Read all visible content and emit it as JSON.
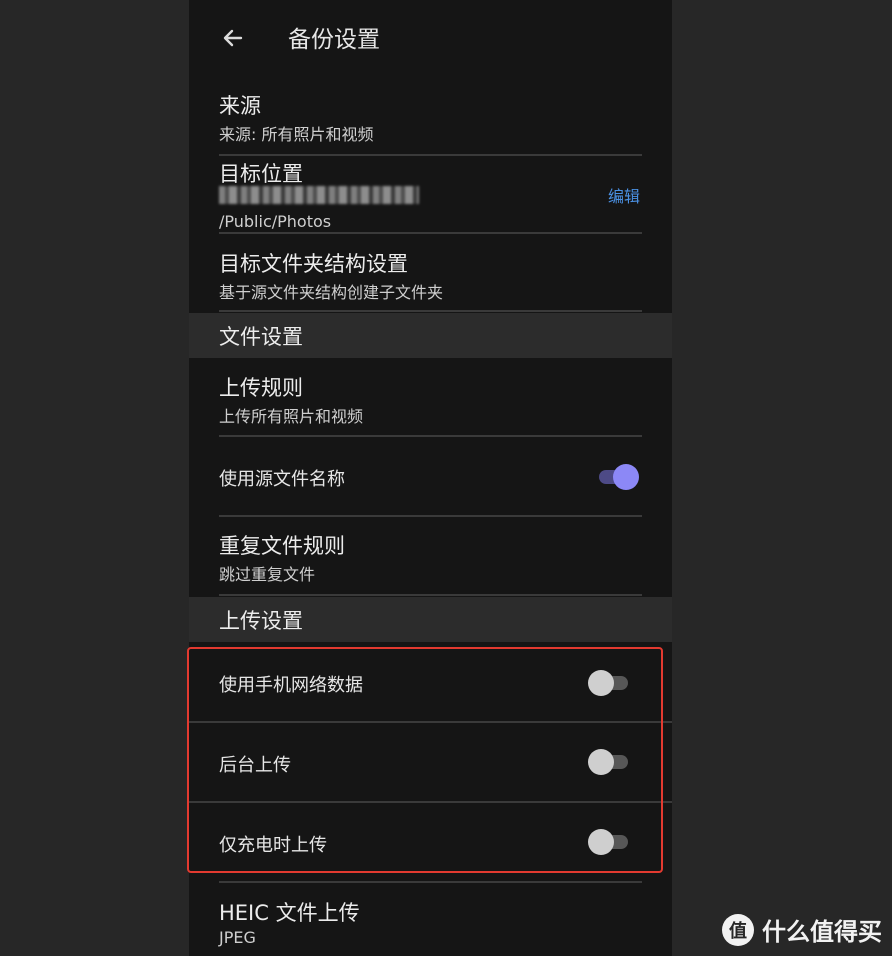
{
  "header": {
    "title": "备份设置"
  },
  "source": {
    "title": "来源",
    "subtitle": "来源: 所有照片和视频"
  },
  "target": {
    "title": "目标位置",
    "path": "/Public/Photos",
    "edit_label": "编辑"
  },
  "folder_structure": {
    "title": "目标文件夹结构设置",
    "subtitle": "基于源文件夹结构创建子文件夹"
  },
  "file_settings": {
    "section_title": "文件设置"
  },
  "upload_rule": {
    "title": "上传规则",
    "subtitle": "上传所有照片和视频"
  },
  "use_source_name": {
    "label": "使用源文件名称",
    "enabled": true
  },
  "duplicate_rule": {
    "title": "重复文件规则",
    "subtitle": "跳过重复文件"
  },
  "upload_settings": {
    "section_title": "上传设置"
  },
  "mobile_data": {
    "label": "使用手机网络数据",
    "enabled": false
  },
  "background_upload": {
    "label": "后台上传",
    "enabled": false
  },
  "charging_only": {
    "label": "仅充电时上传",
    "enabled": false
  },
  "heic_upload": {
    "title": "HEIC 文件上传",
    "subtitle": "JPEG"
  },
  "watermark": {
    "logo_char": "值",
    "text": "什么值得买"
  },
  "colors": {
    "accent": "#8c88f6",
    "link": "#4a90e2",
    "highlight": "#e33a30"
  }
}
